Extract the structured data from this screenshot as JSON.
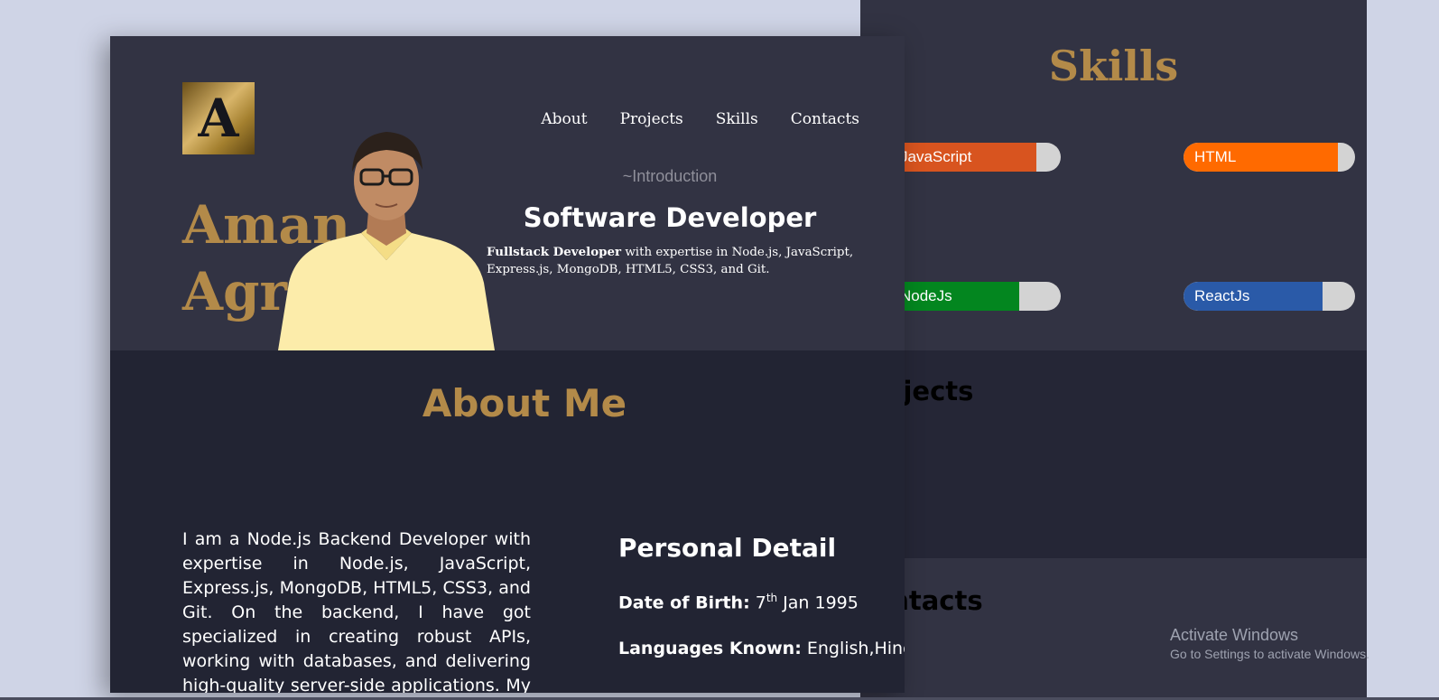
{
  "colors": {
    "page_bg": "#cfd4e6",
    "panel_dark": "#323343",
    "panel_darker": "#222433",
    "accent_gold": "#b38a49"
  },
  "skills_panel": {
    "title": "Skills",
    "skills": [
      {
        "name": "JavaScript",
        "level_pct": 86,
        "color": "#d8541f"
      },
      {
        "name": "HTML",
        "level_pct": 90,
        "color": "#ff6a00"
      },
      {
        "name": "NodeJs",
        "level_pct": 76,
        "color": "#03861f"
      },
      {
        "name": "ReactJs",
        "level_pct": 81,
        "color": "#2a5aa8"
      }
    ],
    "projects_heading": "Projects",
    "contacts_heading": "Contacts"
  },
  "header": {
    "logo_letter": "A",
    "nav": [
      "About",
      "Projects",
      "Skills",
      "Contacts"
    ]
  },
  "hero": {
    "first_name": "Aman",
    "last_name": "Agrawal",
    "kicker": "~Introduction",
    "role": "Software Developer",
    "desc_bold": "Fullstack Developer",
    "desc_rest": " with expertise in Node.js, JavaScript, Express.js, MongoDB, HTML5, CSS3, and Git."
  },
  "about": {
    "title": "About Me",
    "text": "I am a Node.js Backend Developer with expertise in Node.js, JavaScript, Express.js, MongoDB, HTML5, CSS3, and Git. On the backend, I have got specialized in creating robust APIs, working with databases, and delivering high-quality server-side applications. My approach to",
    "personal_title": "Personal Detail",
    "dob_label": "Date of Birth:",
    "dob_day": "7",
    "dob_suffix": "th",
    "dob_rest": " Jan 1995",
    "lang_label": "Languages Known:",
    "lang_value": " English,Hindi"
  },
  "watermark": {
    "line1": "Activate Windows",
    "line2": "Go to Settings to activate Windows."
  }
}
